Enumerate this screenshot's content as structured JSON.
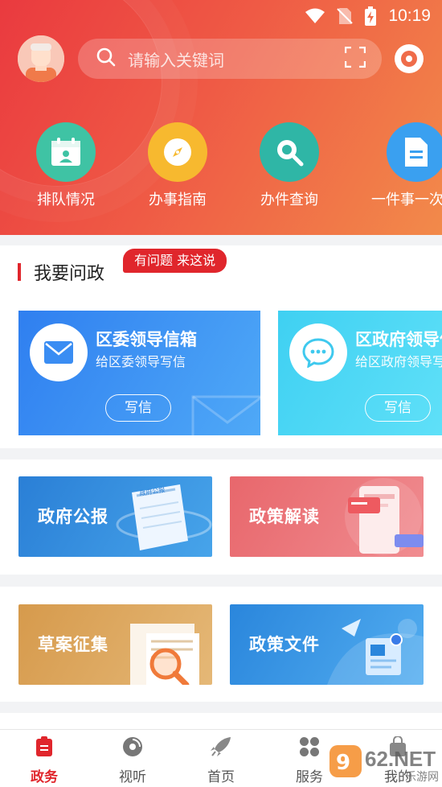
{
  "status_bar": {
    "time": "10:19"
  },
  "search": {
    "placeholder": "请输入关键词"
  },
  "quick_actions": [
    {
      "label": "排队情况",
      "icon": "calendar-person-icon",
      "color": "#3fc3a4"
    },
    {
      "label": "办事指南",
      "icon": "compass-icon",
      "color": "#f7b92f"
    },
    {
      "label": "办件查询",
      "icon": "magnifier-icon",
      "color": "#2fb6a6"
    },
    {
      "label": "一件事一次",
      "icon": "document-icon",
      "color": "#3aa0f0"
    }
  ],
  "section": {
    "title": "我要问政",
    "tag": "有问题 来这说"
  },
  "mailboxes": [
    {
      "title": "区委领导信箱",
      "subtitle": "给区委领导写信",
      "button": "写信",
      "icon": "envelope-icon"
    },
    {
      "title": "区政府领导信箱",
      "subtitle": "给区政府领导写信",
      "button": "写信",
      "icon": "chat-bubble-icon"
    }
  ],
  "tiles": [
    {
      "label": "政府公报",
      "color": "#2f86d8"
    },
    {
      "label": "政策解读",
      "color": "#e96a6e"
    },
    {
      "label": "草案征集",
      "color": "#d9a45a"
    },
    {
      "label": "政策文件",
      "color": "#2b8ee0"
    }
  ],
  "tile_art": {
    "doc_label": "政府公报"
  },
  "tabbar": {
    "items": [
      {
        "label": "政务",
        "icon": "clipboard-icon",
        "active": true
      },
      {
        "label": "视听",
        "icon": "disc-icon",
        "active": false
      },
      {
        "label": "首页",
        "icon": "rocket-icon",
        "active": false
      },
      {
        "label": "服务",
        "icon": "grid-icon",
        "active": false
      },
      {
        "label": "我的",
        "icon": "bag-icon",
        "active": false
      }
    ]
  },
  "watermark": {
    "text": "962.NET",
    "sub": "乐游网"
  },
  "colors": {
    "accent": "#e0262c",
    "header_start": "#ea3a3f",
    "header_end": "#f28a4a"
  }
}
